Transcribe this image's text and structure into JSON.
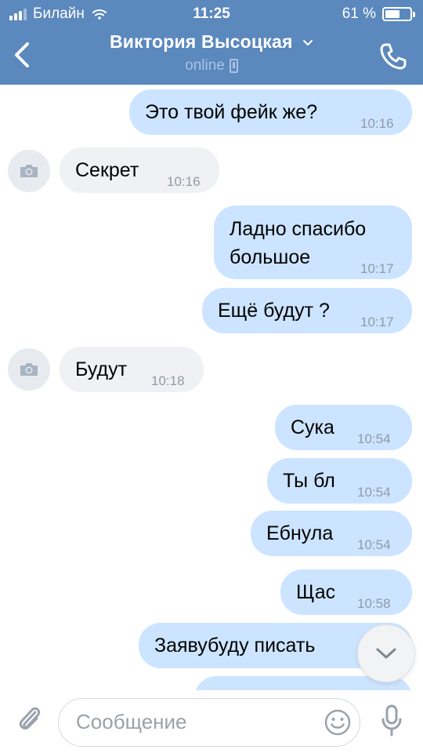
{
  "status_bar": {
    "carrier": "Билайн",
    "time": "11:25",
    "battery_percent": "61 %",
    "battery_level": 0.61
  },
  "header": {
    "contact_name": "Виктория Высоцкая",
    "status": "online",
    "back_icon": "chevron-left-icon",
    "call_icon": "phone-icon",
    "color": "#5b88bd"
  },
  "messages": [
    {
      "direction": "outgoing",
      "text": "Это твой фейк же?",
      "time": "10:16"
    },
    {
      "direction": "incoming",
      "text": "Секрет",
      "time": "10:16"
    },
    {
      "direction": "outgoing",
      "lines": [
        "Ладно спасибо",
        "большое"
      ],
      "time": "10:17"
    },
    {
      "direction": "outgoing",
      "text": "Ещё будут ?",
      "time": "10:17"
    },
    {
      "direction": "incoming",
      "text": "Будут",
      "time": "10:18"
    },
    {
      "direction": "outgoing",
      "text": "Сука",
      "time": "10:54"
    },
    {
      "direction": "outgoing",
      "text": "Ты бл",
      "time": "10:54"
    },
    {
      "direction": "outgoing",
      "text": "Ебнула",
      "time": "10:54"
    },
    {
      "direction": "outgoing",
      "text": "Щас",
      "time": "10:58"
    },
    {
      "direction": "outgoing",
      "text": "Заявубуду писать",
      "time": ""
    }
  ],
  "composer": {
    "placeholder": "Сообщение",
    "attach_icon": "paperclip-icon",
    "emoji_icon": "smiley-icon",
    "mic_icon": "microphone-icon",
    "scroll_icon": "chevron-down-icon"
  },
  "colors": {
    "outgoing_bubble": "#cce4ff",
    "incoming_bubble": "#f0f1f4",
    "time_text": "#8f9aa8"
  }
}
